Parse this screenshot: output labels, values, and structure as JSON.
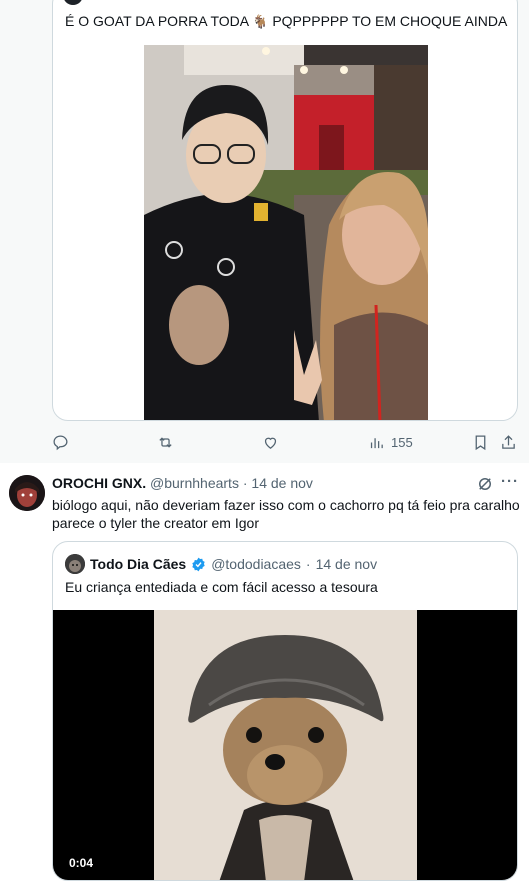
{
  "tweet1": {
    "quoted_text": "É O GOAT DA PORRA TODA",
    "quoted_text_suffix": "PQPPPPPP TO EM CHOQUE AINDA",
    "goat_emoji": "🐐",
    "photo_icon": "selfie-photo",
    "actions": {
      "reply_icon": "reply-icon",
      "retweet_icon": "retweet-icon",
      "like_icon": "like-icon",
      "views_icon": "views-icon",
      "views_count": "155",
      "bookmark_icon": "bookmark-icon",
      "share_icon": "share-icon"
    }
  },
  "tweet2": {
    "author_name": "OROCHI GNX.",
    "author_handle": "@burnhhearts",
    "separator": "·",
    "date": "14 de nov",
    "more_label": "···",
    "text_line1": "biólogo aqui, não deveriam fazer isso com o cachorro pq tá feio pra caralho",
    "text_line2": "parece o tyler the creator em Igor",
    "quote": {
      "author_name": "Todo Dia Cães",
      "author_handle": "@tododiacaes",
      "separator": "·",
      "date": "14 de nov",
      "text": "Eu criança entediada e com fácil acesso a tesoura",
      "video_duration": "0:04"
    }
  },
  "colors": {
    "text_primary": "#0f1419",
    "text_secondary": "#536471",
    "border": "#cfd9de",
    "verified": "#1d9bf0",
    "timeline_bg_highlight": "#f7f9f9"
  }
}
